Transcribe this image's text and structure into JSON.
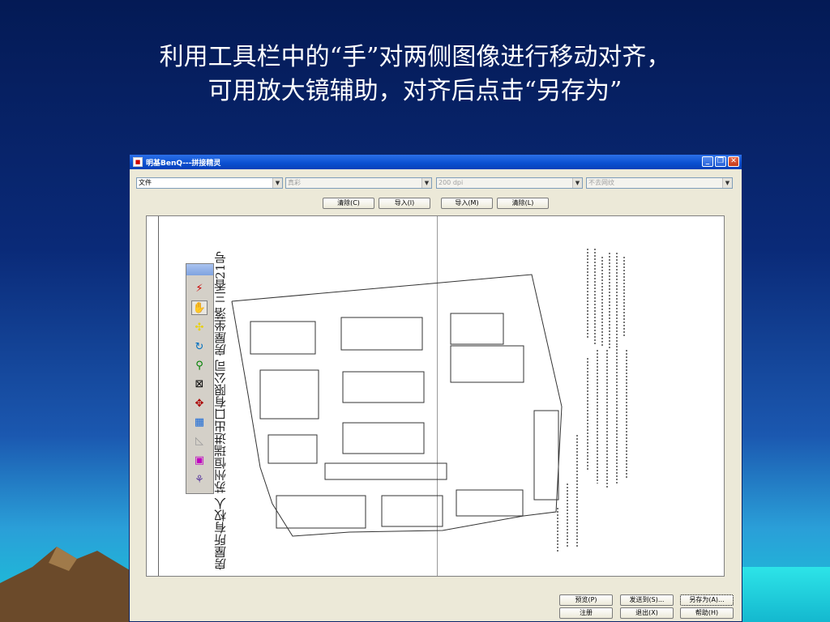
{
  "slide": {
    "line1": "利用工具栏中的“手”对两侧图像进行移动对齐，",
    "line2": "可用放大镜辅助，对齐后点击“另存为”"
  },
  "window": {
    "title": "明基BenQ---拼接精灵",
    "icon": "app-icon",
    "controls": [
      "minimize-icon",
      "restore-icon",
      "close-icon"
    ]
  },
  "combos": {
    "mode": "文件",
    "color": "真彩",
    "dpi": "200 dpi",
    "shrink": "不去网纹"
  },
  "top_buttons": {
    "clear_left": "清除(C)",
    "import_left": "导入(I)",
    "import_right": "导入(M)",
    "clear_right": "清除(L)"
  },
  "toolbox": {
    "tools": [
      "stitch-icon",
      "hand-icon",
      "align-icon",
      "rotate-icon",
      "magnifier-icon",
      "crop-icon",
      "move-icon",
      "grid-icon",
      "slope-icon",
      "color-icon",
      "eraser-icon"
    ]
  },
  "document": {
    "vertical_text": "房屋所有权人    苏州恒瑞进出口有限公司    房屋坐落    三香21号"
  },
  "bottom_buttons": {
    "preview": "预览(P)",
    "send_to": "发送到(S)...",
    "save_as": "另存为(A)...",
    "register": "注册",
    "exit": "退出(X)",
    "help": "帮助(H)"
  },
  "colors": {
    "titlebar": "#0a4fd0",
    "window_bg": "#ece9d8",
    "slide_bg": "#0a2a78"
  }
}
